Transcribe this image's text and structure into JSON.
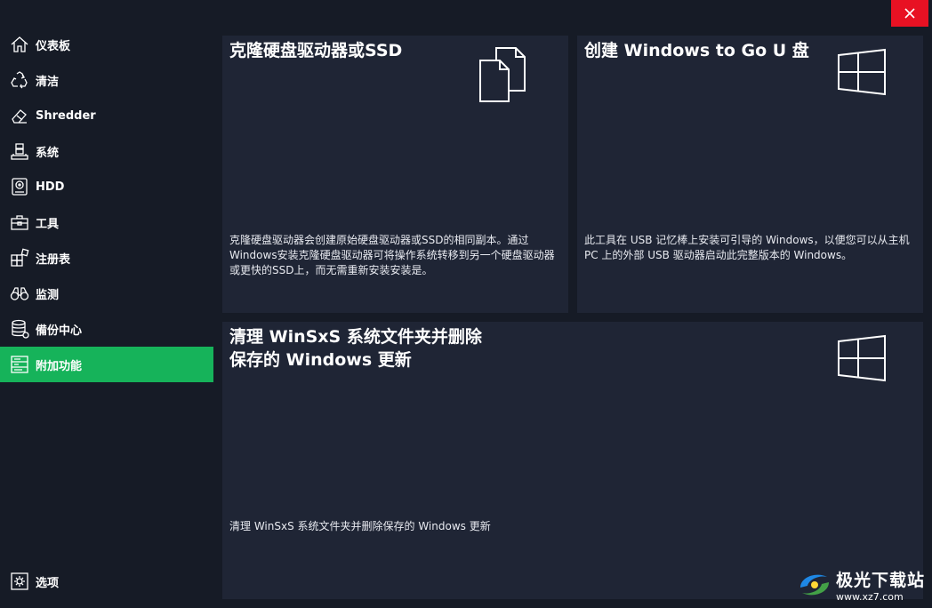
{
  "window": {
    "close_icon": "close-icon"
  },
  "sidebar": {
    "items": [
      {
        "label": "仪表板",
        "icon": "home-icon"
      },
      {
        "label": "清洁",
        "icon": "recycle-icon"
      },
      {
        "label": "Shredder",
        "icon": "eraser-icon"
      },
      {
        "label": "系统",
        "icon": "system-icon"
      },
      {
        "label": "HDD",
        "icon": "hdd-icon"
      },
      {
        "label": "工具",
        "icon": "toolbox-icon"
      },
      {
        "label": "注册表",
        "icon": "registry-icon"
      },
      {
        "label": "监测",
        "icon": "binoculars-icon"
      },
      {
        "label": "備份中心",
        "icon": "database-icon"
      },
      {
        "label": "附加功能",
        "icon": "list-icon",
        "active": true
      }
    ],
    "bottom_item": {
      "label": "选项",
      "icon": "settings-icon"
    },
    "active_color": "#16b35a"
  },
  "cards": {
    "clone": {
      "title": "克隆硬盘驱动器或SSD",
      "desc": "克隆硬盘驱动器会创建原始硬盘驱动器或SSD的相同副本。通过Windows安装克隆硬盘驱动器可将操作系统转移到另一个硬盘驱动器或更快的SSD上，而无需重新安装安装是。"
    },
    "wintogo": {
      "title": "创建 Windows to Go U 盘",
      "desc": "此工具在 USB 记忆棒上安装可引导的 Windows，以便您可以从主机 PC 上的外部 USB 驱动器启动此完整版本的 Windows。"
    },
    "winsxs": {
      "title": "清理 WinSxS 系统文件夹并删除\n保存的 Windows 更新",
      "desc": "清理 WinSxS 系统文件夹并删除保存的 Windows 更新"
    }
  },
  "watermark": {
    "title": "极光下载站",
    "url": "www.xz7.com"
  }
}
